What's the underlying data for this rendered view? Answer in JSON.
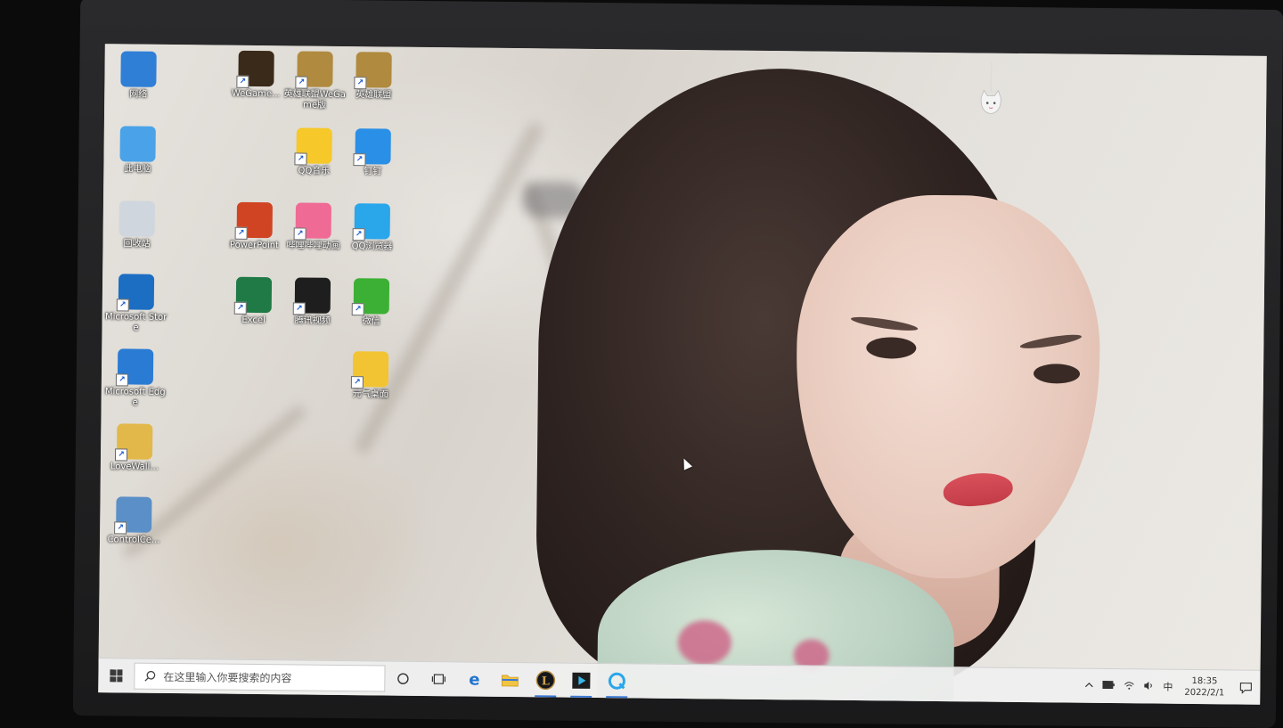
{
  "desktop": {
    "icons": [
      {
        "label": "网络",
        "icon": "network-icon",
        "color": "#2f7fd6"
      },
      {
        "label": "此电脑",
        "icon": "this-pc-icon",
        "color": "#4aa3e8"
      },
      {
        "label": "回收站",
        "icon": "recycle-bin-icon",
        "color": "#cfd6de"
      },
      {
        "label": "Microsoft Store",
        "icon": "store-icon",
        "color": "#1c6ec2"
      },
      {
        "label": "Microsoft Edge",
        "icon": "edge-legacy-icon",
        "color": "#2a7bd4"
      },
      {
        "label": "LoveWall...",
        "icon": "folder-zip-icon",
        "color": "#e2b84a"
      },
      {
        "label": "ControlCe...",
        "icon": "control-center-icon",
        "color": "#5b8fc7"
      },
      {
        "label": "WeGame...",
        "icon": "wegame-icon",
        "color": "#3a2a1a"
      },
      {
        "label": "PowerPoint",
        "icon": "powerpoint-icon",
        "color": "#d04423"
      },
      {
        "label": "Excel",
        "icon": "excel-icon",
        "color": "#1f7a45"
      },
      {
        "label": "英雄联盟WeGame版",
        "icon": "lol-wegame-icon",
        "color": "#b08a3e"
      },
      {
        "label": "QQ音乐",
        "icon": "qq-music-icon",
        "color": "#f6c829"
      },
      {
        "label": "哔哩哔哩动画",
        "icon": "bilibili-icon",
        "color": "#f06a96"
      },
      {
        "label": "腾讯视频",
        "icon": "tencent-video-icon",
        "color": "#1e1e1e"
      },
      {
        "label": "英雄联盟",
        "icon": "lol-icon",
        "color": "#b08a3e"
      },
      {
        "label": "钉钉",
        "icon": "dingtalk-icon",
        "color": "#2a8fe6"
      },
      {
        "label": "QQ浏览器",
        "icon": "qq-browser-icon",
        "color": "#2aa6ea"
      },
      {
        "label": "微信",
        "icon": "wechat-icon",
        "color": "#3cb034"
      },
      {
        "label": "元气桌面",
        "icon": "yuanqi-icon",
        "color": "#f2c433"
      }
    ]
  },
  "taskbar": {
    "search_placeholder": "在这里输入你要搜索的内容",
    "pinned": [
      {
        "name": "edge",
        "icon": "edge-icon"
      },
      {
        "name": "file-explorer",
        "icon": "folder-icon"
      },
      {
        "name": "lol",
        "icon": "lol-icon"
      },
      {
        "name": "tencent-video",
        "icon": "tencent-video-icon"
      },
      {
        "name": "qq-browser",
        "icon": "qq-browser-icon"
      }
    ],
    "tray": {
      "ime": "中",
      "time": "18:35",
      "date": "2022/2/1"
    }
  },
  "colors": {
    "taskbar_bg": "#f0f0f0",
    "accent": "#3a78d4"
  }
}
